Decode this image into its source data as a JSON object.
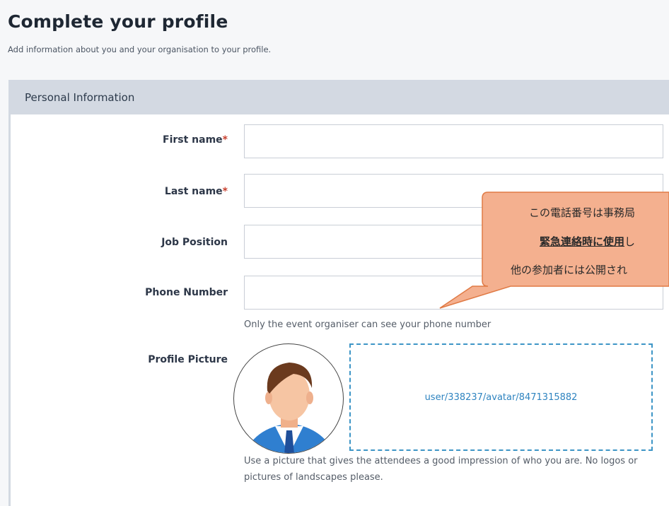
{
  "page": {
    "title": "Complete your profile",
    "subtitle": "Add information about you and your organisation to your profile."
  },
  "section": {
    "title": "Personal Information"
  },
  "fields": {
    "first_name": {
      "label": "First name",
      "required_mark": "*",
      "value": ""
    },
    "last_name": {
      "label": "Last name",
      "required_mark": "*",
      "value": ""
    },
    "job_position": {
      "label": "Job Position",
      "value": ""
    },
    "phone_number": {
      "label": "Phone Number",
      "value": "",
      "hint": "Only the event organiser can see your phone number"
    },
    "profile_picture": {
      "label": "Profile Picture",
      "upload_link": "user/338237/avatar/8471315882",
      "hint": "Use a picture that gives the attendees a good impression of who you are. No logos or pictures of landscapes please."
    }
  },
  "callout": {
    "line1": "この電話番号は事務局",
    "line2_bold": "緊急連絡時に使用",
    "line2_rest": "し",
    "line3": "他の参加者には公開され",
    "fill": "#f4b08f",
    "stroke": "#e07a45"
  }
}
